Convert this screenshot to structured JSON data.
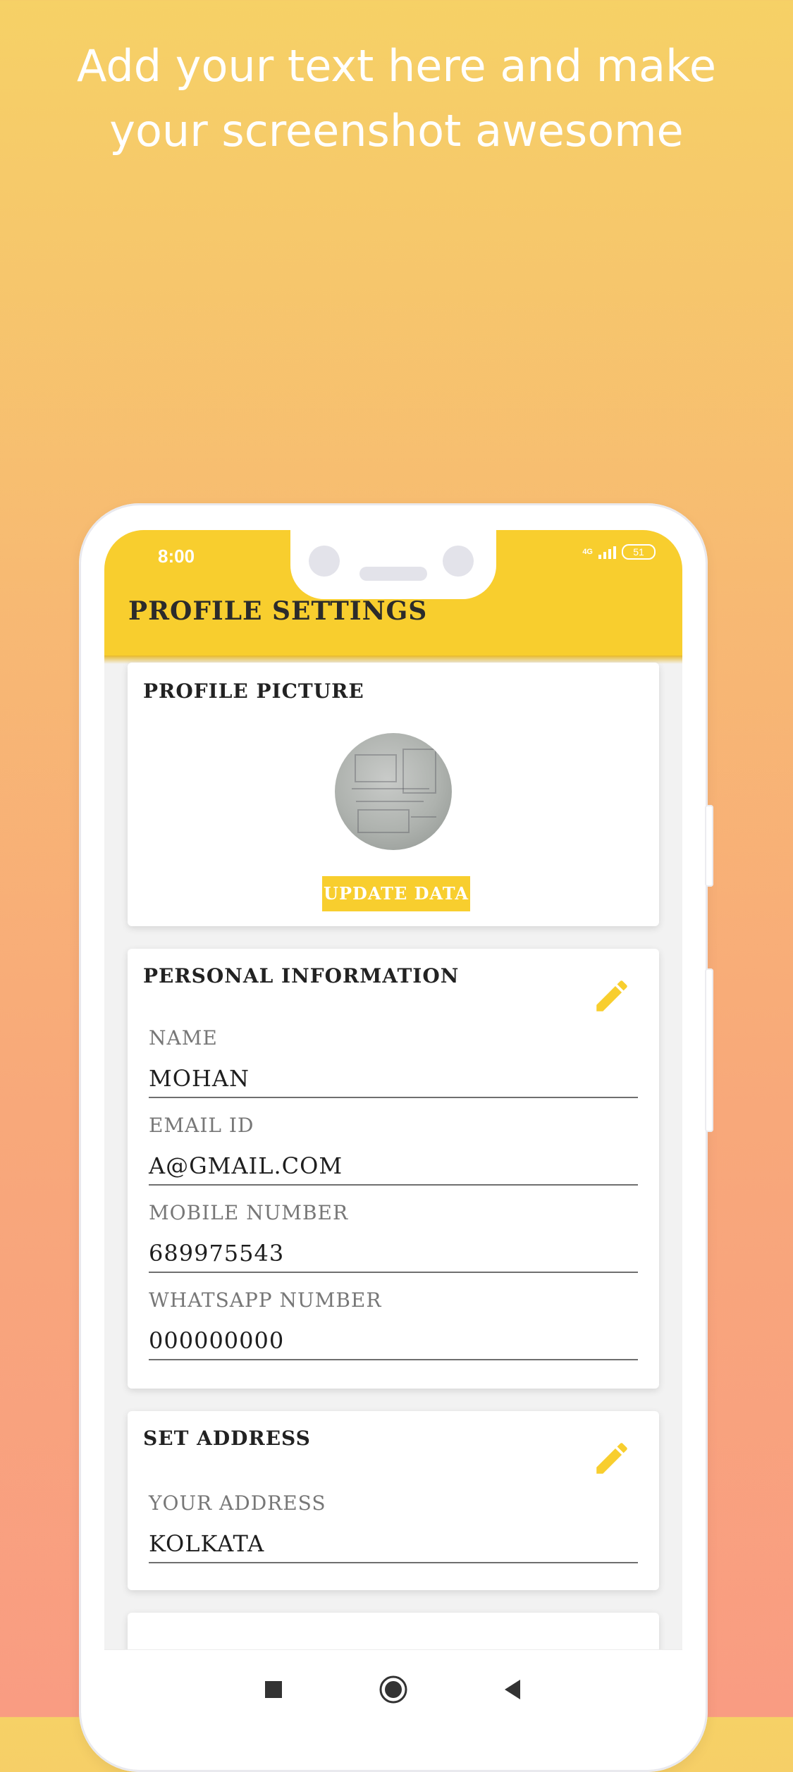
{
  "banner": {
    "line1": "Add your text here and make",
    "line2": "your screenshot awesome"
  },
  "status_bar": {
    "time": "8:00",
    "network": "4G",
    "battery": "51"
  },
  "app_bar": {
    "title": "PROFILE SETTINGS"
  },
  "profile_picture_card": {
    "title": "PROFILE PICTURE",
    "update_button": "UPDATE DATA"
  },
  "personal_info_card": {
    "title": "PERSONAL INFORMATION",
    "fields": [
      {
        "label": "NAME",
        "value": "MOHAN"
      },
      {
        "label": "EMAIL ID",
        "value": "A@GMAIL.COM"
      },
      {
        "label": "MOBILE NUMBER",
        "value": "689975543"
      },
      {
        "label": "WHATSAPP NUMBER",
        "value": "000000000"
      }
    ]
  },
  "address_card": {
    "title": "SET ADDRESS",
    "field": {
      "label": "YOUR ADDRESS",
      "value": "KOLKATA"
    }
  },
  "nav_bar": {
    "icons": [
      "recents-square-icon",
      "home-circle-icon",
      "back-triangle-icon"
    ]
  },
  "colors": {
    "accent": "#f8ce2e",
    "gradient_top": "#f6d166",
    "gradient_bottom": "#f99c82"
  }
}
